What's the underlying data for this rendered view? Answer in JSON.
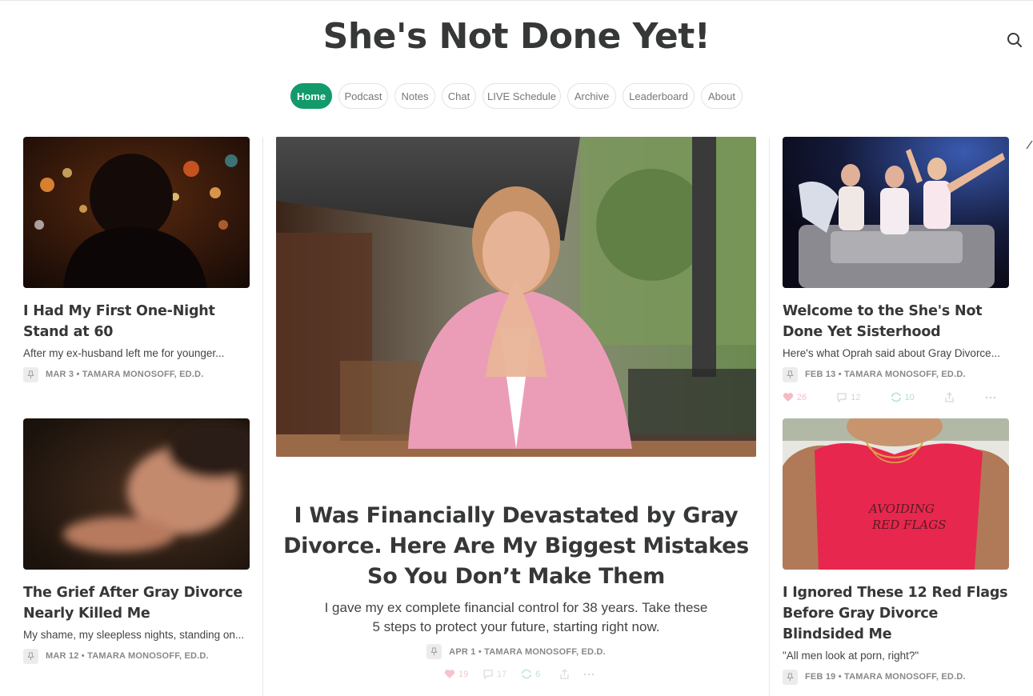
{
  "site": {
    "title": "She's Not Done Yet!"
  },
  "icons": {
    "search": "search-icon",
    "pin": "pin-icon",
    "heart": "heart-icon",
    "comment": "comment-icon",
    "restack": "restack-icon",
    "share": "share-icon",
    "more": "more-icon"
  },
  "colors": {
    "accent": "#129a6b",
    "text": "#363737",
    "heart": "#e0405a",
    "restack": "#1aa179"
  },
  "nav": {
    "items": [
      {
        "label": "Home",
        "active": true
      },
      {
        "label": "Podcast"
      },
      {
        "label": "Notes"
      },
      {
        "label": "Chat"
      },
      {
        "label": "LIVE Schedule"
      },
      {
        "label": "Archive"
      },
      {
        "label": "Leaderboard"
      },
      {
        "label": "About"
      }
    ]
  },
  "featured": {
    "title": "I Was Financially Devastated by Gray Divorce. Here Are My Biggest Mistakes So You Don’t Make Them",
    "subtitle": "I gave my ex complete financial control for 38 years. Take these 5 steps to protect your future, starting right now.",
    "meta": "APR 1 • TAMARA MONOSOFF, ED.D.",
    "likes": "19",
    "comments": "17",
    "restacks": "6"
  },
  "left_posts": [
    {
      "title": "I Had My First One-Night Stand at 60",
      "subtitle": "After my ex-husband left me for younger...",
      "meta": "MAR 3 • TAMARA MONOSOFF, ED.D."
    },
    {
      "title": "The Grief After Gray Divorce Nearly Killed Me",
      "subtitle": "My shame, my sleepless nights, standing on...",
      "meta": "MAR 12 • TAMARA MONOSOFF, ED.D."
    }
  ],
  "right_posts": [
    {
      "title": "Welcome to the She's Not Done Yet Sisterhood",
      "subtitle": "Here's what Oprah said about Gray Divorce...",
      "meta": "FEB 13 • TAMARA MONOSOFF, ED.D.",
      "likes": "26",
      "comments": "12",
      "restacks": "10"
    },
    {
      "title": "I Ignored These 12 Red Flags Before Gray Divorce Blindsided Me",
      "subtitle": "\"All men look at porn, right?\"",
      "meta": "FEB 19 • TAMARA MONOSOFF, ED.D.",
      "shirt_text_1": "AVOIDING",
      "shirt_text_2": "RED FLAGS"
    }
  ]
}
